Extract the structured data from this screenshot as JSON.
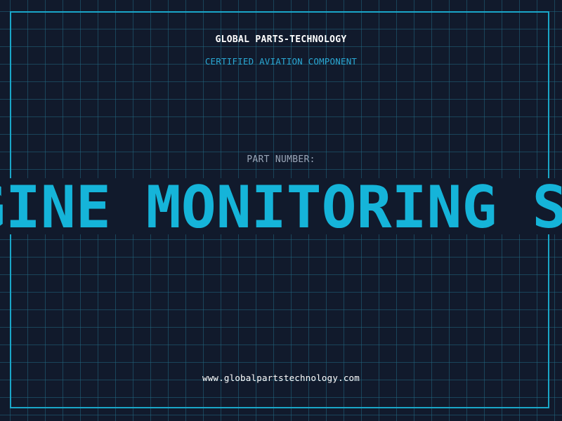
{
  "header": {
    "company": "GLOBAL PARTS-TECHNOLOGY",
    "subtitle": "CERTIFIED AVIATION COMPONENT"
  },
  "main": {
    "part_label": "PART NUMBER:",
    "part_number": "ENGINE MONITORING SYSTEM"
  },
  "footer": {
    "website": "www.globalpartstechnology.com"
  },
  "colors": {
    "background": "#111a2c",
    "grid": "#216680",
    "frame": "#1aa6c8",
    "accent": "#15b4d9"
  }
}
